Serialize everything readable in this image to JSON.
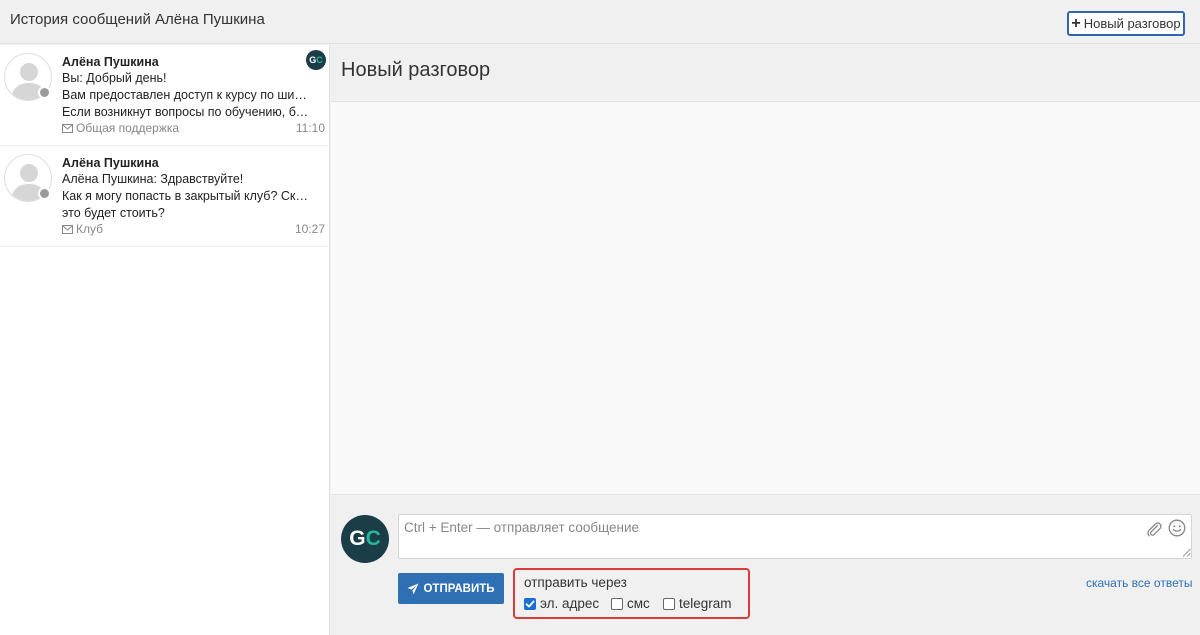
{
  "header": {
    "title": "История сообщений Алёна Пушкина",
    "new_conversation_label": "Новый разговор"
  },
  "sidebar": {
    "conversations": [
      {
        "name": "Алёна Пушкина",
        "lines": [
          "Вы: Добрый день!",
          "Вам предоставлен доступ к курсу по шитью.",
          "Если возникнут вопросы по обучению, буд..."
        ],
        "tag": "Общая поддержка",
        "time": "11:10",
        "badge": "GC"
      },
      {
        "name": "Алёна Пушкина",
        "lines": [
          "Алёна Пушкина: Здравствуйте!",
          "Как я могу попасть в закрытый клуб? Сколько",
          "это будет стоить?"
        ],
        "tag": "Клуб",
        "time": "10:27"
      }
    ]
  },
  "main": {
    "title": "Новый разговор"
  },
  "composer": {
    "avatar_letters": [
      "G",
      "C"
    ],
    "placeholder": "Ctrl + Enter — отправляет сообщение",
    "send_label": "ОТПРАВИТЬ",
    "send_via": {
      "label": "отправить через",
      "options": [
        {
          "label": "эл. адрес",
          "checked": true
        },
        {
          "label": "смс",
          "checked": false
        },
        {
          "label": "telegram",
          "checked": false
        }
      ]
    },
    "download_label": "скачать все ответы"
  },
  "colors": {
    "accent": "#2f6fb3",
    "highlight_border": "#d93a3a",
    "brand_dark": "#1b3d48",
    "brand_green": "#25b79a"
  }
}
